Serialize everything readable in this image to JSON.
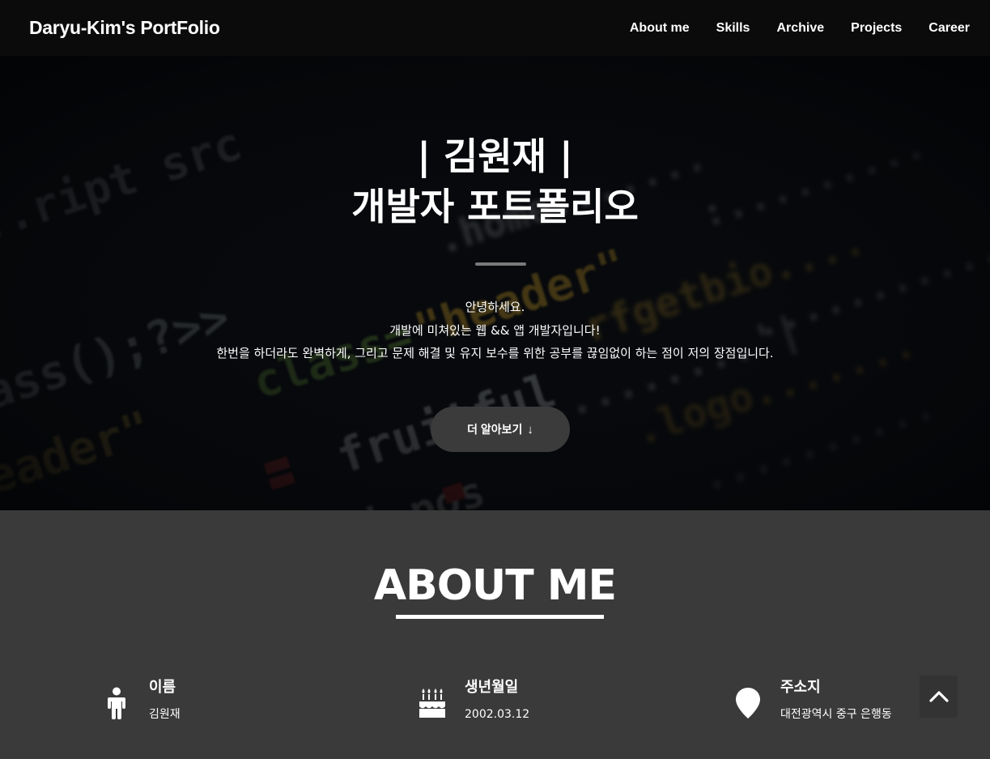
{
  "nav": {
    "brand": "Daryu-Kim's PortFolio",
    "links": [
      "About me",
      "Skills",
      "Archive",
      "Projects",
      "Career"
    ]
  },
  "hero": {
    "title_line1": "| 김원재 |",
    "title_line2": "개발자 포트폴리오",
    "intro": [
      "안녕하세요.",
      "개발에 미쳐있는 웹 && 앱 개발자입니다!",
      "한번을 하더라도 완벽하게, 그리고 문제 해결 및 유지 보수를 위한 공부를 끊임없이 하는 점이 저의 장점입니다."
    ],
    "button_label": "더 알아보기",
    "button_arrow": "↓"
  },
  "about": {
    "title": "ABOUT ME",
    "items": [
      {
        "icon": "person-icon",
        "label": "이름",
        "value": "김원재"
      },
      {
        "icon": "birthday-cake-icon",
        "label": "생년월일",
        "value": "2002.03.12"
      },
      {
        "icon": "map-marker-icon",
        "label": "주소지",
        "value": "대전광역시 중구 은행동"
      }
    ]
  },
  "scroll_top": {
    "icon": "chevron-up-icon"
  }
}
